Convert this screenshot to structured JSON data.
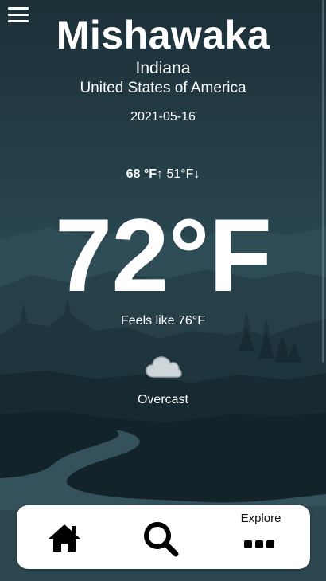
{
  "location": {
    "city": "Mishawaka",
    "state": "Indiana",
    "country": "United States of America"
  },
  "date": "2021-05-16",
  "forecast": {
    "high": "68 °F↑",
    "low": "51°F↓"
  },
  "current": {
    "temperature": "72°F",
    "feels_like": "Feels like 76°F",
    "condition": "Overcast",
    "condition_icon": "cloud-icon"
  },
  "navbar": {
    "home_icon": "home-icon",
    "search_icon": "search-icon",
    "explore_label": "Explore",
    "more_icon": "more-dots-icon"
  },
  "colors": {
    "background": "#1d3139",
    "text": "#ffffff",
    "navbar_bg": "#ffffff",
    "navbar_icon": "#000000"
  }
}
